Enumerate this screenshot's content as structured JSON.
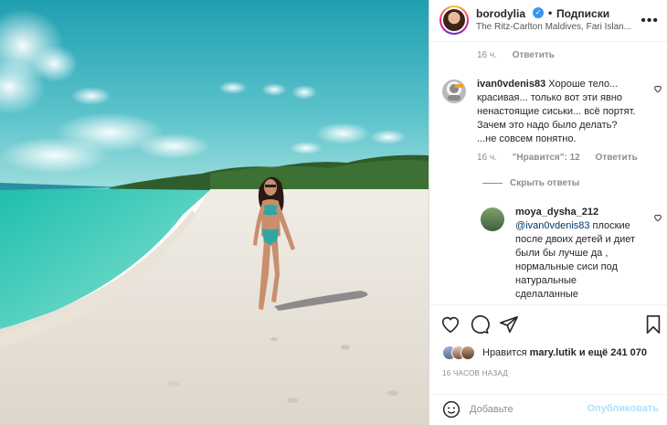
{
  "post": {
    "username": "borodylia",
    "follow_label": "Подписки",
    "location": "The Ritz-Carlton Maldives, Fari Islan...",
    "more_icon": "more-horizontal-icon"
  },
  "first_meta": {
    "time": "16 ч.",
    "reply": "Ответить"
  },
  "comments": [
    {
      "username": "ivan0vdenis83",
      "text": "Хороше тело... красивая... только вот эти явно ненастоящие сиськи... всё портят. Зачем это надо было делать? ...не совсем понятно.",
      "time": "16 ч.",
      "likes": "\"Нравится\": 12",
      "reply": "Ответить"
    }
  ],
  "hide_replies": "Скрыть ответы",
  "reply": {
    "username": "moya_dysha_212",
    "mention": "@ivan0vdenis83",
    "text": " плоские после двоих детей и диет были бы лучше да , нормальные сиси под натуральные сделаланные"
  },
  "likes": {
    "prefix": "Нравится ",
    "user": "mary.lutik",
    "suffix": " и ещё 241 070"
  },
  "time_ago": "16 ЧАСОВ НАЗАД",
  "add_comment": {
    "placeholder": "Добавьте",
    "post_label": "Опубликовать"
  },
  "colors": {
    "verified": "#3897f0",
    "link": "#00376b",
    "post_disabled": "#b2dffc",
    "muted": "#8e8e8e"
  }
}
